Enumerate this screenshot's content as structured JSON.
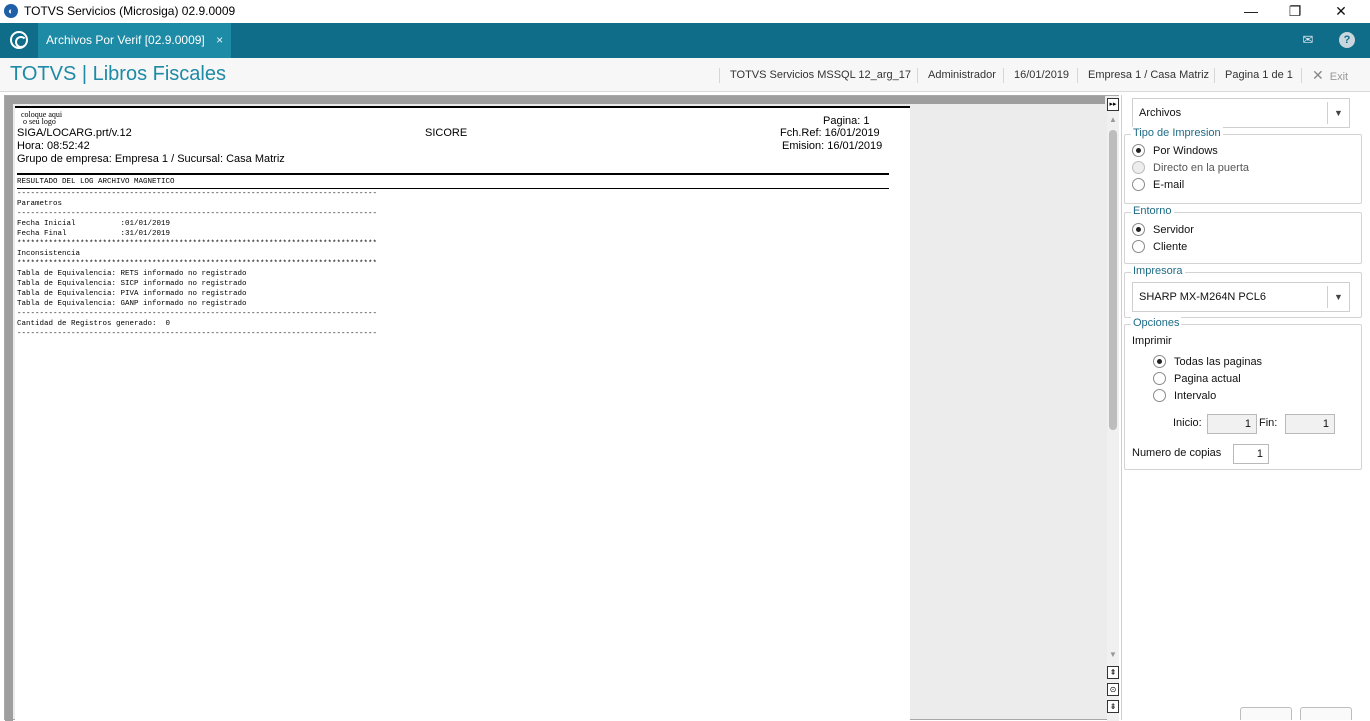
{
  "window": {
    "title": "TOTVS Servicios (Microsiga) 02.9.0009",
    "minimize_glyph": "—",
    "maximize_glyph": "❐",
    "close_glyph": "✕"
  },
  "header": {
    "tab_label": "Archivos Por Verif [02.9.0009]",
    "tab_close": "×",
    "mail_icon": "✉",
    "help_icon": "?"
  },
  "module_bar": {
    "title": "TOTVS | Libros Fiscales",
    "environment": "TOTVS Servicios MSSQL 12_arg_17",
    "user": "Administrador",
    "date": "16/01/2019",
    "company": "Empresa 1 / Casa Matriz",
    "page_info": "Pagina 1 de 1",
    "exit_x": "✕",
    "exit_label": "Exit"
  },
  "report": {
    "logo_line1": "coloque aqui",
    "logo_line2": "o seu logo",
    "program": "SIGA/LOCARG.prt/v.12",
    "name": "SICORE",
    "hora": "Hora: 08:52:42",
    "grupo": "Grupo de empresa: Empresa 1 / Sucursal: Casa Matriz",
    "pagina": "Pagina:    1",
    "fch_ref": "Fch.Ref: 16/01/2019",
    "emision": "Emision: 16/01/2019",
    "section_title": "RESULTADO DEL LOG ARCHIVO MAGNETICO",
    "body_lines": [
      "--------------------------------------------------------------------------------",
      "Parametros",
      "--------------------------------------------------------------------------------",
      "Fecha Inicial          :01/01/2019",
      "Fecha Final            :31/01/2019",
      "********************************************************************************",
      "Inconsistencia",
      "********************************************************************************",
      "Tabla de Equivalencia: RETS informado no registrado",
      "Tabla de Equivalencia: SICP informado no registrado",
      "Tabla de Equivalencia: PIVA informado no registrado",
      "Tabla de Equivalencia: GANP informado no registrado",
      "--------------------------------------------------------------------------------",
      "Cantidad de Registros generado:  0",
      "--------------------------------------------------------------------------------"
    ]
  },
  "scrollbar": {
    "expand_glyph": "▸▸",
    "up_arrow": "▲",
    "down_arrow": "▼",
    "nav_up": "⇞",
    "nav_mid": "⊙",
    "nav_down": "⇟"
  },
  "panel": {
    "output_combo": "Archivos",
    "combo_caret": "▼",
    "tipo_impresion": {
      "legend": "Tipo de Impresion",
      "options": [
        "Por Windows",
        "Directo en la puerta",
        "E-mail"
      ],
      "selected": "Por Windows"
    },
    "entorno": {
      "legend": "Entorno",
      "options": [
        "Servidor",
        "Cliente"
      ],
      "selected": "Servidor"
    },
    "impresora": {
      "legend": "Impresora",
      "value": "SHARP MX-M264N PCL6"
    },
    "opciones": {
      "legend": "Opciones",
      "imprimir_label": "Imprimir",
      "options": [
        "Todas las paginas",
        "Pagina actual",
        "Intervalo"
      ],
      "selected": "Todas las paginas",
      "inicio_label": "Inicio:",
      "inicio_value": "1",
      "fin_label": "Fin:",
      "fin_value": "1",
      "copias_label": "Numero de copias",
      "copias_value": "1"
    }
  }
}
